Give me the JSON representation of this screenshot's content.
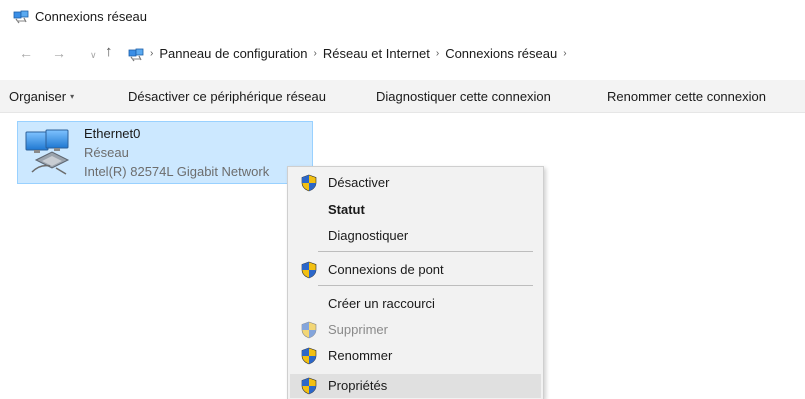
{
  "window": {
    "title": "Connexions réseau",
    "icon": "network-connections-icon"
  },
  "address": {
    "crumbs": [
      "Panneau de configuration",
      "Réseau et Internet",
      "Connexions réseau"
    ],
    "nav": {
      "back": "←",
      "forward": "→",
      "recent": "∨",
      "up": "↑"
    },
    "separator": "›"
  },
  "toolbar": {
    "organize": "Organiser",
    "disable": "Désactiver ce périphérique réseau",
    "diagnose": "Diagnostiquer cette connexion",
    "rename": "Renommer cette connexion",
    "dropdown_glyph": "▾"
  },
  "connection": {
    "name": "Ethernet0",
    "type": "Réseau",
    "adapter": "Intel(R) 82574L Gigabit Network",
    "icon": "ethernet-adapter-icon",
    "selected_color": "#cce8ff"
  },
  "context_menu": {
    "items": [
      {
        "label": "Désactiver",
        "shield": true
      },
      {
        "label": "Statut",
        "bold": true
      },
      {
        "label": "Diagnostiquer"
      },
      {
        "label": "Connexions de pont",
        "shield": true
      },
      {
        "label": "Créer un raccourci"
      },
      {
        "label": "Supprimer",
        "shield": true,
        "disabled": true
      },
      {
        "label": "Renommer",
        "shield": true
      },
      {
        "label": "Propriétés",
        "shield": true,
        "highlighted": true
      }
    ]
  }
}
